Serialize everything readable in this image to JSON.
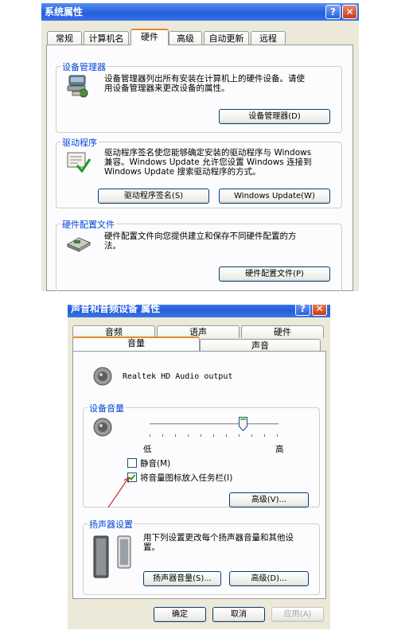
{
  "dialog1": {
    "title": "系统属性",
    "help_btn": "?",
    "close_btn": "✕",
    "tabs": [
      "常规",
      "计算机名",
      "硬件",
      "高级",
      "自动更新",
      "远程"
    ],
    "active_tab": "硬件",
    "device_manager": {
      "title": "设备管理器",
      "desc_line1": "设备管理器列出所有安装在计算机上的硬件设备。请使",
      "desc_line2": "用设备管理器来更改设备的属性。",
      "button": "设备管理器(D)",
      "icon": "device-manager-icon"
    },
    "drivers": {
      "title": "驱动程序",
      "desc_line1": "驱动程序签名使您能够确定安装的驱动程序与 Windows",
      "desc_line2": "兼容。Windows Update 允许您设置 Windows 连接到",
      "desc_line3": "Windows Update 搜索驱动程序的方式。",
      "button_signing": "驱动程序签名(S)",
      "button_update": "Windows Update(W)",
      "icon": "driver-signing-icon"
    },
    "hardware_profiles": {
      "title": "硬件配置文件",
      "desc_line1": "硬件配置文件向您提供建立和保存不同硬件配置的方",
      "desc_line2": "法。",
      "button": "硬件配置文件(P)",
      "icon": "hardware-profiles-icon"
    }
  },
  "dialog2": {
    "title": "声音和音频设备 属性",
    "help_btn": "?",
    "close_btn": "✕",
    "tabs_row1": [
      "音频",
      "语声",
      "硬件"
    ],
    "tabs_row2": [
      "音量",
      "声音"
    ],
    "active_tab": "音量",
    "device_name": "Realtek HD Audio output",
    "device_volume": {
      "title": "设备音量",
      "low_label": "低",
      "high_label": "高",
      "level_percent": 72
    },
    "mute_label": "静音(M)",
    "mute_checked": false,
    "taskbar_label": "将音量图标放入任务栏(I)",
    "taskbar_checked": true,
    "advanced_button": "高级(V)...",
    "speaker_settings": {
      "title": "扬声器设置",
      "desc_line1": "用下列设置更改每个扬声器音量和其他设",
      "desc_line2": "置。",
      "speaker_volume_button": "扬声器音量(S)...",
      "advanced_button": "高级(D)..."
    },
    "ok_button": "确定",
    "cancel_button": "取消",
    "apply_button": "应用(A)"
  },
  "colors": {
    "titlebar": "#245edb",
    "group_title": "#0046d5",
    "dialog_bg": "#ece9d8",
    "annotation_arrow": "#d0282c"
  }
}
